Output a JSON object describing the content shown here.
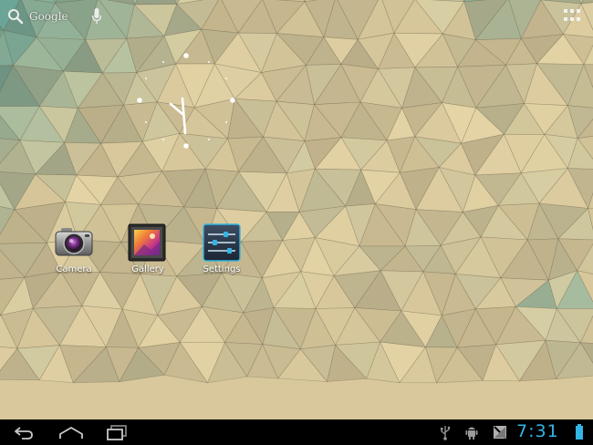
{
  "status_bar": {
    "time": "7:31"
  },
  "search": {
    "label": "Google"
  },
  "shortcuts": [
    {
      "label": "Camera",
      "icon": "camera-icon"
    },
    {
      "label": "Gallery",
      "icon": "gallery-icon"
    },
    {
      "label": "Settings",
      "icon": "settings-icon"
    }
  ],
  "navigation": {
    "back_icon": "back-icon",
    "home_icon": "home-icon",
    "recents_icon": "recent-apps-icon"
  },
  "notifications": [
    "usb-icon",
    "android-debug-icon",
    "notification-icon",
    "battery-icon"
  ],
  "colors": {
    "accent": "#33b5e5",
    "wallpaper_light": "#d8c89c",
    "wallpaper_teal": "#5f9a8e",
    "system_bar": "#000000"
  }
}
